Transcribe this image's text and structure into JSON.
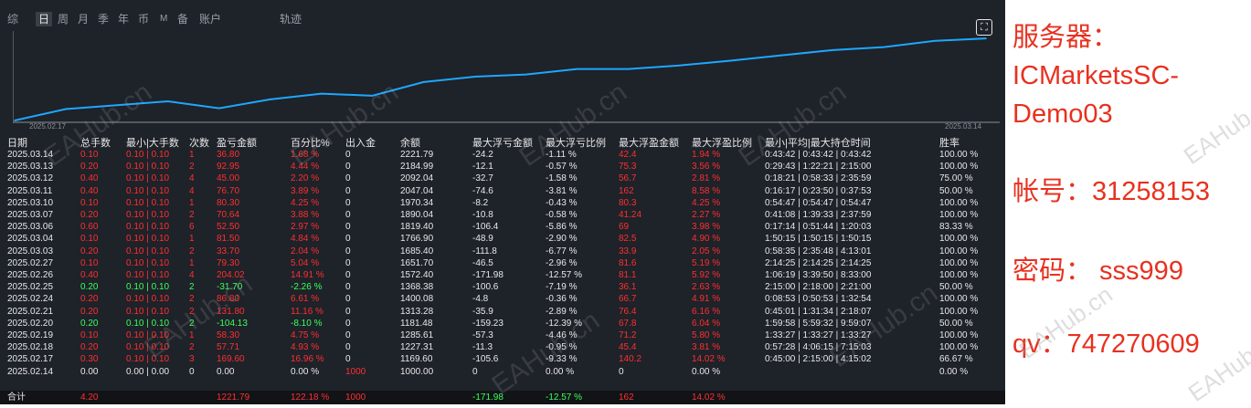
{
  "tabs": [
    "综",
    "日",
    "周",
    "月",
    "季",
    "年",
    "币",
    "M",
    "备",
    "账户",
    "轨迹"
  ],
  "active_tab": "日",
  "chart": {
    "start_label": "2025.02.17",
    "end_label": "2025.03.14",
    "line_color": "#1ea7ff"
  },
  "chart_data": {
    "type": "line",
    "x": [
      "2025.02.14",
      "2025.02.17",
      "2025.02.18",
      "2025.02.19",
      "2025.02.20",
      "2025.02.21",
      "2025.02.24",
      "2025.02.25",
      "2025.02.26",
      "2025.02.27",
      "2025.03.03",
      "2025.03.04",
      "2025.03.05",
      "2025.03.06",
      "2025.03.07",
      "2025.03.10",
      "2025.03.11",
      "2025.03.12",
      "2025.03.13",
      "2025.03.14"
    ],
    "y": [
      1000.0,
      1169.6,
      1227.31,
      1285.61,
      1181.48,
      1313.28,
      1400.08,
      1368.38,
      1572.4,
      1651.7,
      1685.4,
      1766.9,
      1766.9,
      1819.4,
      1890.04,
      1970.34,
      2047.04,
      2092.04,
      2184.99,
      2221.79
    ],
    "ylim": [
      1000,
      2250
    ]
  },
  "headers": [
    "日期",
    "总手数",
    "最小|大手数",
    "次数",
    "盈亏金额",
    "百分比%",
    "出入金",
    "余额",
    "最大浮亏金额",
    "最大浮亏比例",
    "最大浮盈金额",
    "最大浮盈比例",
    "最小|平均|最大持仓时间",
    "胜率"
  ],
  "rows": [
    {
      "date": "2025.03.14",
      "lots": "0.10",
      "minmax": "0.10 | 0.10",
      "count": "1",
      "pnl": "36.80",
      "pct": "1.68 %",
      "io": "0",
      "balance": "2221.79",
      "max_dd": "-24.2",
      "max_dd_pct": "-1.11 %",
      "max_fp": "42.4",
      "max_fp_pct": "1.94 %",
      "hold": "0:43:42 | 0:43:42 | 0:43:42",
      "win": "100.00 %",
      "tone": "red"
    },
    {
      "date": "2025.03.13",
      "lots": "0.20",
      "minmax": "0.10 | 0.10",
      "count": "2",
      "pnl": "92.95",
      "pct": "4.44 %",
      "io": "0",
      "balance": "2184.99",
      "max_dd": "-12.1",
      "max_dd_pct": "-0.57 %",
      "max_fp": "75.3",
      "max_fp_pct": "3.56 %",
      "hold": "0:29:43 | 1:22:21 | 2:15:00",
      "win": "100.00 %",
      "tone": "red"
    },
    {
      "date": "2025.03.12",
      "lots": "0.40",
      "minmax": "0.10 | 0.10",
      "count": "4",
      "pnl": "45.00",
      "pct": "2.20 %",
      "io": "0",
      "balance": "2092.04",
      "max_dd": "-32.7",
      "max_dd_pct": "-1.58 %",
      "max_fp": "56.7",
      "max_fp_pct": "2.81 %",
      "hold": "0:18:21 | 0:58:33 | 2:35:59",
      "win": "75.00 %",
      "tone": "red"
    },
    {
      "date": "2025.03.11",
      "lots": "0.40",
      "minmax": "0.10 | 0.10",
      "count": "4",
      "pnl": "76.70",
      "pct": "3.89 %",
      "io": "0",
      "balance": "2047.04",
      "max_dd": "-74.6",
      "max_dd_pct": "-3.81 %",
      "max_fp": "162",
      "max_fp_pct": "8.58 %",
      "hold": "0:16:17 | 0:23:50 | 0:37:53",
      "win": "50.00 %",
      "tone": "red"
    },
    {
      "date": "2025.03.10",
      "lots": "0.10",
      "minmax": "0.10 | 0.10",
      "count": "1",
      "pnl": "80.30",
      "pct": "4.25 %",
      "io": "0",
      "balance": "1970.34",
      "max_dd": "-8.2",
      "max_dd_pct": "-0.43 %",
      "max_fp": "80.3",
      "max_fp_pct": "4.25 %",
      "hold": "0:54:47 | 0:54:47 | 0:54:47",
      "win": "100.00 %",
      "tone": "red"
    },
    {
      "date": "2025.03.07",
      "lots": "0.20",
      "minmax": "0.10 | 0.10",
      "count": "2",
      "pnl": "70.64",
      "pct": "3.88 %",
      "io": "0",
      "balance": "1890.04",
      "max_dd": "-10.8",
      "max_dd_pct": "-0.58 %",
      "max_fp": "41.24",
      "max_fp_pct": "2.27 %",
      "hold": "0:41:08 | 1:39:33 | 2:37:59",
      "win": "100.00 %",
      "tone": "red"
    },
    {
      "date": "2025.03.06",
      "lots": "0.60",
      "minmax": "0.10 | 0.10",
      "count": "6",
      "pnl": "52.50",
      "pct": "2.97 %",
      "io": "0",
      "balance": "1819.40",
      "max_dd": "-106.4",
      "max_dd_pct": "-5.86 %",
      "max_fp": "69",
      "max_fp_pct": "3.98 %",
      "hold": "0:17:14 | 0:51:44 | 1:20:03",
      "win": "83.33 %",
      "tone": "red"
    },
    {
      "date": "2025.03.04",
      "lots": "0.10",
      "minmax": "0.10 | 0.10",
      "count": "1",
      "pnl": "81.50",
      "pct": "4.84 %",
      "io": "0",
      "balance": "1766.90",
      "max_dd": "-48.9",
      "max_dd_pct": "-2.90 %",
      "max_fp": "82.5",
      "max_fp_pct": "4.90 %",
      "hold": "1:50:15 | 1:50:15 | 1:50:15",
      "win": "100.00 %",
      "tone": "red"
    },
    {
      "date": "2025.03.03",
      "lots": "0.20",
      "minmax": "0.10 | 0.10",
      "count": "2",
      "pnl": "33.70",
      "pct": "2.04 %",
      "io": "0",
      "balance": "1685.40",
      "max_dd": "-111.8",
      "max_dd_pct": "-6.77 %",
      "max_fp": "33.9",
      "max_fp_pct": "2.05 %",
      "hold": "0:58:35 | 2:35:48 | 4:13:01",
      "win": "100.00 %",
      "tone": "red"
    },
    {
      "date": "2025.02.27",
      "lots": "0.10",
      "minmax": "0.10 | 0.10",
      "count": "1",
      "pnl": "79.30",
      "pct": "5.04 %",
      "io": "0",
      "balance": "1651.70",
      "max_dd": "-46.5",
      "max_dd_pct": "-2.96 %",
      "max_fp": "81.6",
      "max_fp_pct": "5.19 %",
      "hold": "2:14:25 | 2:14:25 | 2:14:25",
      "win": "100.00 %",
      "tone": "red"
    },
    {
      "date": "2025.02.26",
      "lots": "0.40",
      "minmax": "0.10 | 0.10",
      "count": "4",
      "pnl": "204.02",
      "pct": "14.91 %",
      "io": "0",
      "balance": "1572.40",
      "max_dd": "-171.98",
      "max_dd_pct": "-12.57 %",
      "max_fp": "81.1",
      "max_fp_pct": "5.92 %",
      "hold": "1:06:19 | 3:39:50 | 8:33:00",
      "win": "100.00 %",
      "tone": "red"
    },
    {
      "date": "2025.02.25",
      "lots": "0.20",
      "minmax": "0.10 | 0.10",
      "count": "2",
      "pnl": "-31.70",
      "pct": "-2.26 %",
      "io": "0",
      "balance": "1368.38",
      "max_dd": "-100.6",
      "max_dd_pct": "-7.19 %",
      "max_fp": "36.1",
      "max_fp_pct": "2.63 %",
      "hold": "2:15:00 | 2:18:00 | 2:21:00",
      "win": "50.00 %",
      "tone": "green"
    },
    {
      "date": "2025.02.24",
      "lots": "0.20",
      "minmax": "0.10 | 0.10",
      "count": "2",
      "pnl": "86.80",
      "pct": "6.61 %",
      "io": "0",
      "balance": "1400.08",
      "max_dd": "-4.8",
      "max_dd_pct": "-0.36 %",
      "max_fp": "66.7",
      "max_fp_pct": "4.91 %",
      "hold": "0:08:53 | 0:50:53 | 1:32:54",
      "win": "100.00 %",
      "tone": "red"
    },
    {
      "date": "2025.02.21",
      "lots": "0.20",
      "minmax": "0.10 | 0.10",
      "count": "2",
      "pnl": "131.80",
      "pct": "11.16 %",
      "io": "0",
      "balance": "1313.28",
      "max_dd": "-35.9",
      "max_dd_pct": "-2.89 %",
      "max_fp": "76.4",
      "max_fp_pct": "6.16 %",
      "hold": "0:45:01 | 1:31:34 | 2:18:07",
      "win": "100.00 %",
      "tone": "red"
    },
    {
      "date": "2025.02.20",
      "lots": "0.20",
      "minmax": "0.10 | 0.10",
      "count": "2",
      "pnl": "-104.13",
      "pct": "-8.10 %",
      "io": "0",
      "balance": "1181.48",
      "max_dd": "-159.23",
      "max_dd_pct": "-12.39 %",
      "max_fp": "67.8",
      "max_fp_pct": "6.04 %",
      "hold": "1:59:58 | 5:59:32 | 9:59:07",
      "win": "50.00 %",
      "tone": "green"
    },
    {
      "date": "2025.02.19",
      "lots": "0.10",
      "minmax": "0.10 | 0.10",
      "count": "1",
      "pnl": "58.30",
      "pct": "4.75 %",
      "io": "0",
      "balance": "1285.61",
      "max_dd": "-57.3",
      "max_dd_pct": "-4.46 %",
      "max_fp": "71.2",
      "max_fp_pct": "5.80 %",
      "hold": "1:33:27 | 1:33:27 | 1:33:27",
      "win": "100.00 %",
      "tone": "red"
    },
    {
      "date": "2025.02.18",
      "lots": "0.20",
      "minmax": "0.10 | 0.10",
      "count": "2",
      "pnl": "57.71",
      "pct": "4.93 %",
      "io": "0",
      "balance": "1227.31",
      "max_dd": "-11.3",
      "max_dd_pct": "-0.95 %",
      "max_fp": "45.4",
      "max_fp_pct": "3.81 %",
      "hold": "0:57:28 | 4:06:15 | 7:15:03",
      "win": "100.00 %",
      "tone": "red"
    },
    {
      "date": "2025.02.17",
      "lots": "0.30",
      "minmax": "0.10 | 0.10",
      "count": "3",
      "pnl": "169.60",
      "pct": "16.96 %",
      "io": "0",
      "balance": "1169.60",
      "max_dd": "-105.6",
      "max_dd_pct": "-9.33 %",
      "max_fp": "140.2",
      "max_fp_pct": "14.02 %",
      "hold": "0:45:00 | 2:15:00 | 4:15:02",
      "win": "66.67 %",
      "tone": "red"
    },
    {
      "date": "2025.02.14",
      "lots": "0.00",
      "minmax": "0.00 | 0.00",
      "count": "0",
      "pnl": "0.00",
      "pct": "0.00 %",
      "io": "1000",
      "balance": "1000.00",
      "max_dd": "0",
      "max_dd_pct": "0.00 %",
      "max_fp": "0",
      "max_fp_pct": "0.00 %",
      "hold": "",
      "win": "0.00 %",
      "tone": "white"
    }
  ],
  "total": {
    "label": "合计",
    "lots": "4.20",
    "pnl": "1221.79",
    "pct": "122.18 %",
    "io": "1000",
    "max_dd": "-171.98",
    "max_dd_pct": "-12.57 %",
    "max_fp": "162",
    "max_fp_pct": "14.02 %"
  },
  "right": {
    "server_label": "服务器：",
    "server_name_1": "ICMarketsSC-",
    "server_name_2": "Demo03",
    "account": "帐号：31258153",
    "password": "密码：  sss999",
    "qv": "qv：747270609"
  },
  "watermark": "EAHub.cn",
  "colors": {
    "red": "#ff2f2f",
    "green": "#3dff5a",
    "panel": "#1e2229",
    "accent_text": "#e8311f"
  }
}
